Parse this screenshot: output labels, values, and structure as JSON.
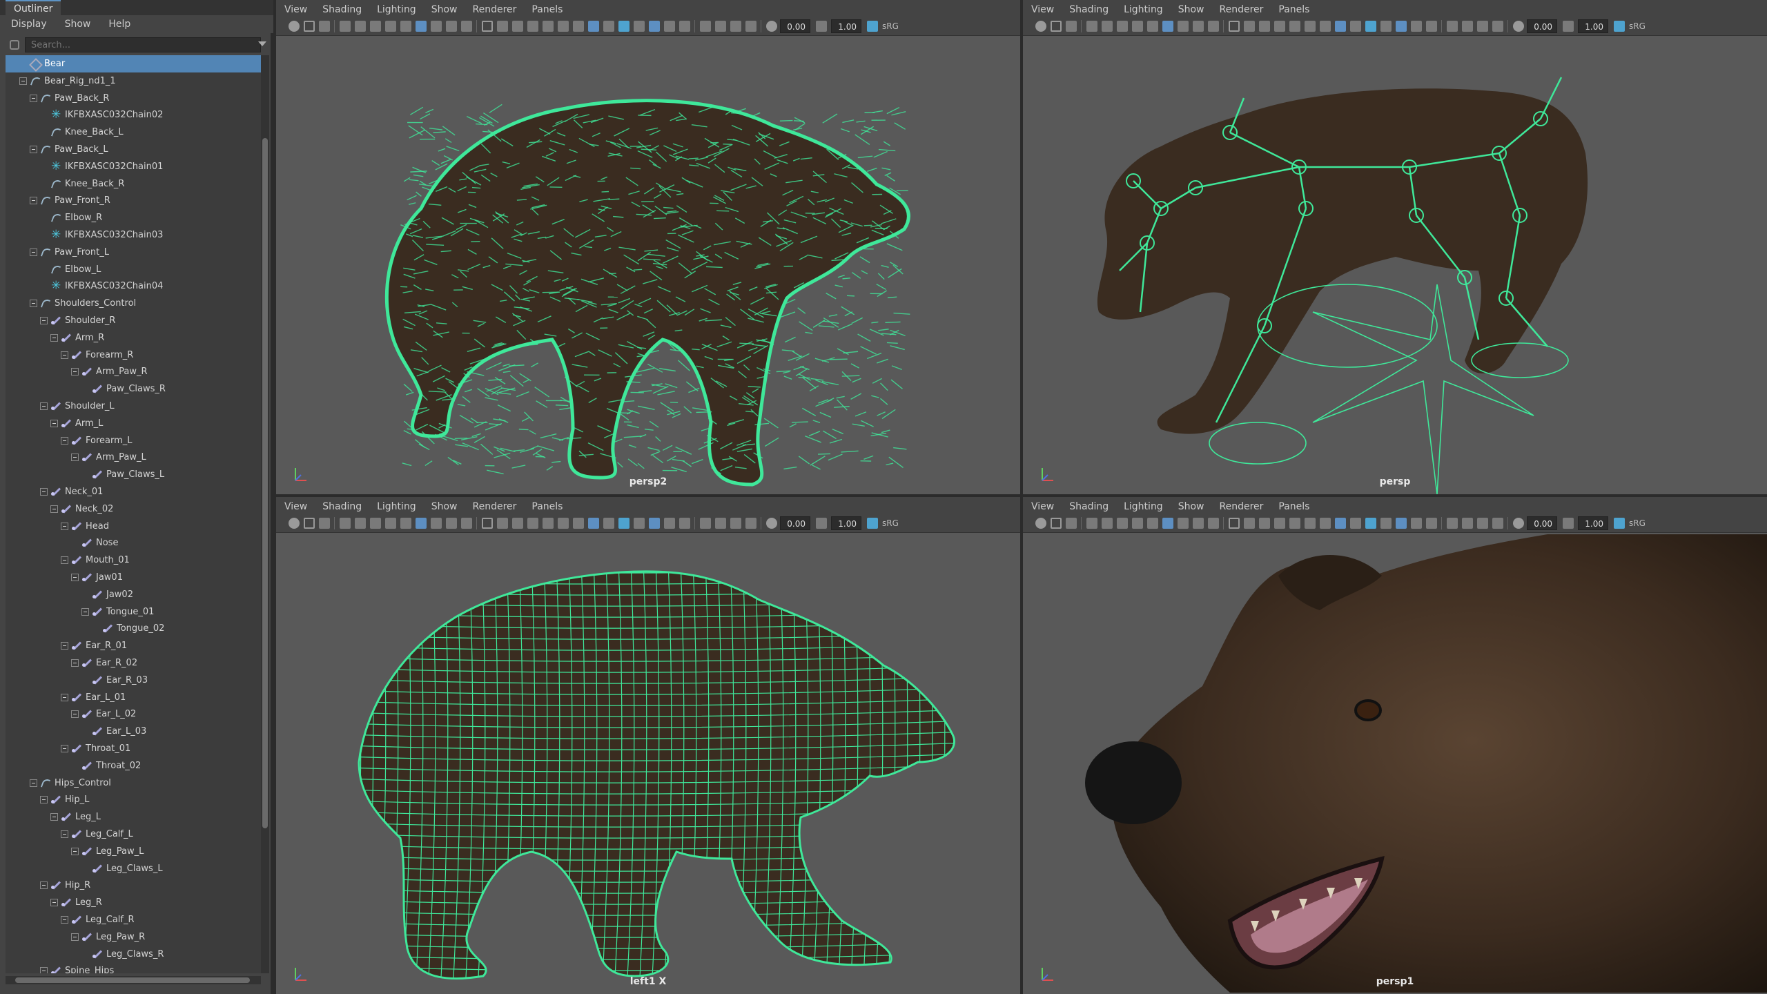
{
  "outliner": {
    "tab": "Outliner",
    "menu": [
      "Display",
      "Show",
      "Help"
    ],
    "search_placeholder": "Search...",
    "rows": [
      {
        "label": "Bear",
        "depth": 2,
        "icon": "xform",
        "exp": false,
        "sel": true
      },
      {
        "label": "Bear_Rig_nd1_1",
        "depth": 2,
        "icon": "curve",
        "exp": true
      },
      {
        "label": "Paw_Back_R",
        "depth": 3,
        "icon": "curve",
        "exp": true
      },
      {
        "label": "IKFBXASC032Chain02",
        "depth": 4,
        "icon": "ik",
        "exp": false
      },
      {
        "label": "Knee_Back_L",
        "depth": 4,
        "icon": "curve",
        "exp": false
      },
      {
        "label": "Paw_Back_L",
        "depth": 3,
        "icon": "curve",
        "exp": true
      },
      {
        "label": "IKFBXASC032Chain01",
        "depth": 4,
        "icon": "ik",
        "exp": false
      },
      {
        "label": "Knee_Back_R",
        "depth": 4,
        "icon": "curve",
        "exp": false
      },
      {
        "label": "Paw_Front_R",
        "depth": 3,
        "icon": "curve",
        "exp": true
      },
      {
        "label": "Elbow_R",
        "depth": 4,
        "icon": "curve",
        "exp": false
      },
      {
        "label": "IKFBXASC032Chain03",
        "depth": 4,
        "icon": "ik",
        "exp": false
      },
      {
        "label": "Paw_Front_L",
        "depth": 3,
        "icon": "curve",
        "exp": true
      },
      {
        "label": "Elbow_L",
        "depth": 4,
        "icon": "curve",
        "exp": false
      },
      {
        "label": "IKFBXASC032Chain04",
        "depth": 4,
        "icon": "ik",
        "exp": false
      },
      {
        "label": "Shoulders_Control",
        "depth": 3,
        "icon": "curve",
        "exp": true
      },
      {
        "label": "Shoulder_R",
        "depth": 4,
        "icon": "joint",
        "exp": true
      },
      {
        "label": "Arm_R",
        "depth": 5,
        "icon": "joint",
        "exp": true
      },
      {
        "label": "Forearm_R",
        "depth": 6,
        "icon": "joint",
        "exp": true
      },
      {
        "label": "Arm_Paw_R",
        "depth": 7,
        "icon": "joint",
        "exp": true
      },
      {
        "label": "Paw_Claws_R",
        "depth": 8,
        "icon": "joint",
        "exp": false
      },
      {
        "label": "Shoulder_L",
        "depth": 4,
        "icon": "joint",
        "exp": true
      },
      {
        "label": "Arm_L",
        "depth": 5,
        "icon": "joint",
        "exp": true
      },
      {
        "label": "Forearm_L",
        "depth": 6,
        "icon": "joint",
        "exp": true
      },
      {
        "label": "Arm_Paw_L",
        "depth": 7,
        "icon": "joint",
        "exp": true
      },
      {
        "label": "Paw_Claws_L",
        "depth": 8,
        "icon": "joint",
        "exp": false
      },
      {
        "label": "Neck_01",
        "depth": 4,
        "icon": "joint",
        "exp": true
      },
      {
        "label": "Neck_02",
        "depth": 5,
        "icon": "joint",
        "exp": true
      },
      {
        "label": "Head",
        "depth": 6,
        "icon": "joint",
        "exp": true
      },
      {
        "label": "Nose",
        "depth": 7,
        "icon": "joint",
        "exp": false
      },
      {
        "label": "Mouth_01",
        "depth": 6,
        "icon": "joint",
        "exp": true
      },
      {
        "label": "Jaw01",
        "depth": 7,
        "icon": "joint",
        "exp": true
      },
      {
        "label": "Jaw02",
        "depth": 8,
        "icon": "joint",
        "exp": false
      },
      {
        "label": "Tongue_01",
        "depth": 8,
        "icon": "joint",
        "exp": true
      },
      {
        "label": "Tongue_02",
        "depth": 9,
        "icon": "joint",
        "exp": false
      },
      {
        "label": "Ear_R_01",
        "depth": 6,
        "icon": "joint",
        "exp": true
      },
      {
        "label": "Ear_R_02",
        "depth": 7,
        "icon": "joint",
        "exp": true
      },
      {
        "label": "Ear_R_03",
        "depth": 8,
        "icon": "joint",
        "exp": false
      },
      {
        "label": "Ear_L_01",
        "depth": 6,
        "icon": "joint",
        "exp": true
      },
      {
        "label": "Ear_L_02",
        "depth": 7,
        "icon": "joint",
        "exp": true
      },
      {
        "label": "Ear_L_03",
        "depth": 8,
        "icon": "joint",
        "exp": false
      },
      {
        "label": "Throat_01",
        "depth": 6,
        "icon": "joint",
        "exp": true
      },
      {
        "label": "Throat_02",
        "depth": 7,
        "icon": "joint",
        "exp": false
      },
      {
        "label": "Hips_Control",
        "depth": 3,
        "icon": "curve",
        "exp": true
      },
      {
        "label": "Hip_L",
        "depth": 4,
        "icon": "joint",
        "exp": true
      },
      {
        "label": "Leg_L",
        "depth": 5,
        "icon": "joint",
        "exp": true
      },
      {
        "label": "Leg_Calf_L",
        "depth": 6,
        "icon": "joint",
        "exp": true
      },
      {
        "label": "Leg_Paw_L",
        "depth": 7,
        "icon": "joint",
        "exp": true
      },
      {
        "label": "Leg_Claws_L",
        "depth": 8,
        "icon": "joint",
        "exp": false
      },
      {
        "label": "Hip_R",
        "depth": 4,
        "icon": "joint",
        "exp": true
      },
      {
        "label": "Leg_R",
        "depth": 5,
        "icon": "joint",
        "exp": true
      },
      {
        "label": "Leg_Calf_R",
        "depth": 6,
        "icon": "joint",
        "exp": true
      },
      {
        "label": "Leg_Paw_R",
        "depth": 7,
        "icon": "joint",
        "exp": true
      },
      {
        "label": "Leg_Claws_R",
        "depth": 8,
        "icon": "joint",
        "exp": false
      },
      {
        "label": "Spine_Hips",
        "depth": 4,
        "icon": "joint",
        "exp": true
      }
    ]
  },
  "panel_menu": [
    "View",
    "Shading",
    "Lighting",
    "Show",
    "Renderer",
    "Panels"
  ],
  "toolbar": {
    "exposure": "0.00",
    "gamma": "1.00",
    "colorspace": "sRG"
  },
  "viewports": [
    {
      "id": "tl",
      "camera": "persp2",
      "mode": "hair"
    },
    {
      "id": "tr",
      "camera": "persp",
      "mode": "skeleton"
    },
    {
      "id": "bl",
      "camera": "left1 X",
      "mode": "wireframe"
    },
    {
      "id": "br",
      "camera": "persp1",
      "mode": "closeup"
    }
  ],
  "colors": {
    "accent": "#5285b5",
    "wire": "#3fe89a",
    "fur": "#3a2c20"
  }
}
